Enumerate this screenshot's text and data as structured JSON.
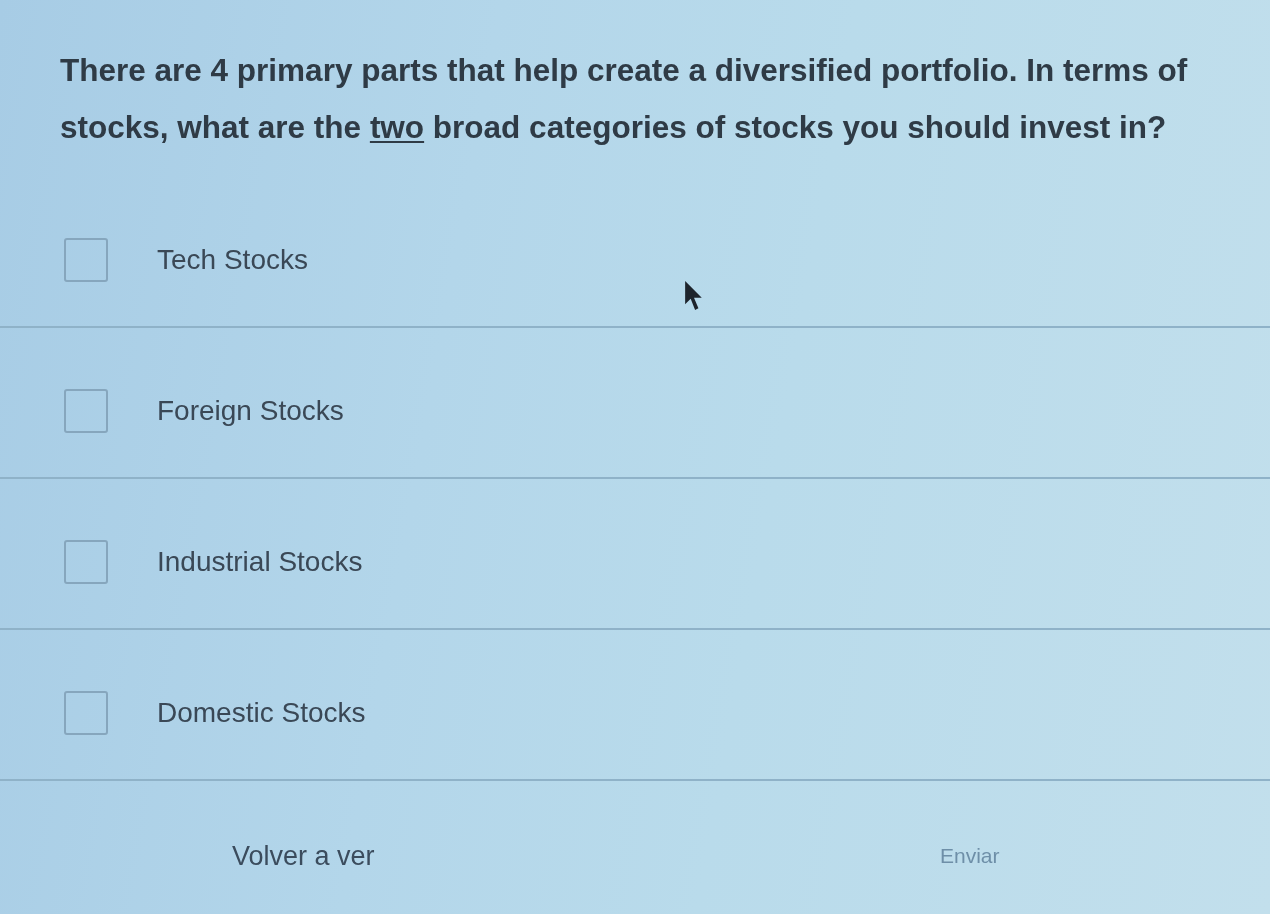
{
  "question": {
    "text": "There are 4 primary parts that help create a diversified portfolio. In terms of stocks, what are the **two** broad categories of stocks you should invest in?"
  },
  "options": [
    {
      "label": "Tech Stocks",
      "checked": false
    },
    {
      "label": "Foreign Stocks",
      "checked": false
    },
    {
      "label": "Industrial Stocks",
      "checked": false
    },
    {
      "label": "Domestic Stocks",
      "checked": false
    }
  ],
  "actions": [
    {
      "label": "Volver a ver",
      "disabled": false
    },
    {
      "label": "Enviar",
      "disabled": true
    }
  ]
}
